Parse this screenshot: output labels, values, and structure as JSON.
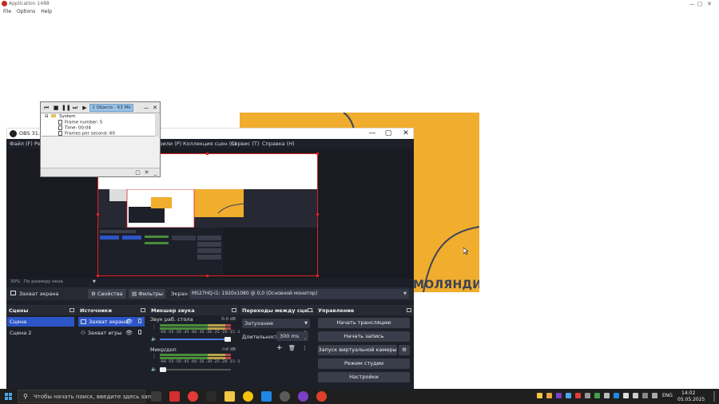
{
  "app": {
    "title": "Application 1488",
    "menu": [
      "File",
      "Options",
      "Help"
    ],
    "controls": [
      "minimize-icon",
      "maximize-icon",
      "close-icon"
    ]
  },
  "background_canvas": {
    "color": "#f0ad2e",
    "text": "МОЛЯНДИЯ",
    "text_color": "#3a4357"
  },
  "stats_window": {
    "objects_label": "2 Objects - 63 Mb",
    "tree_root": "System",
    "tree_items": [
      "Frame number: 5",
      "Time: 00:04",
      "Frames per second: 60"
    ]
  },
  "obs": {
    "title": "OBS 31.0.3 -",
    "menu": [
      "Файл (F)",
      "Ре",
      "фили (P)",
      "Коллекция сцен (S)",
      "Сервис (T)",
      "Справка (H)"
    ],
    "zoom": {
      "percent": "30%",
      "mode": "По размеру окна"
    },
    "source_bar": {
      "selected_source": "Захват экрана",
      "properties_button": "Свойства",
      "filters_button": "Фильтры",
      "screen_label": "Экран",
      "monitor_value": "MS27HQ-i1: 1920x1080 @ 0,0 (Основной монитор)"
    },
    "docks": {
      "scenes": {
        "title": "Сцены",
        "items": [
          {
            "label": "Сцена",
            "active": true
          },
          {
            "label": "Сцена 2",
            "active": false
          }
        ]
      },
      "sources": {
        "title": "Источники",
        "items": [
          {
            "label": "Захват экрана",
            "active": true
          },
          {
            "label": "Захват игры",
            "active": false
          }
        ]
      },
      "mixer": {
        "title": "Микшер звука",
        "scale": "-60 -55 -50 -45 -40 -35 -30 -25 -20 -15 -10 -5 0",
        "channels": [
          {
            "name": "Звук раб. стола",
            "db": "0.0 dB",
            "volume": 1.0
          },
          {
            "name": "Микр/доп",
            "db": "-inf dB",
            "volume": 0.0
          }
        ]
      },
      "transitions": {
        "title": "Переходы между сце...",
        "selected": "Затухание",
        "duration_label": "Длительность",
        "duration_value": "300 ms"
      },
      "controls": {
        "title": "Управление",
        "buttons": [
          "Начать трансляцию",
          "Начать запись",
          "Запуск виртуальной камеры",
          "Режим студии",
          "Настройки"
        ]
      }
    }
  },
  "taskbar": {
    "search_placeholder": "Чтобы начать поиск, введите здесь запрос",
    "language": "ENG",
    "time": "14:02",
    "date": "05.05.2025"
  }
}
